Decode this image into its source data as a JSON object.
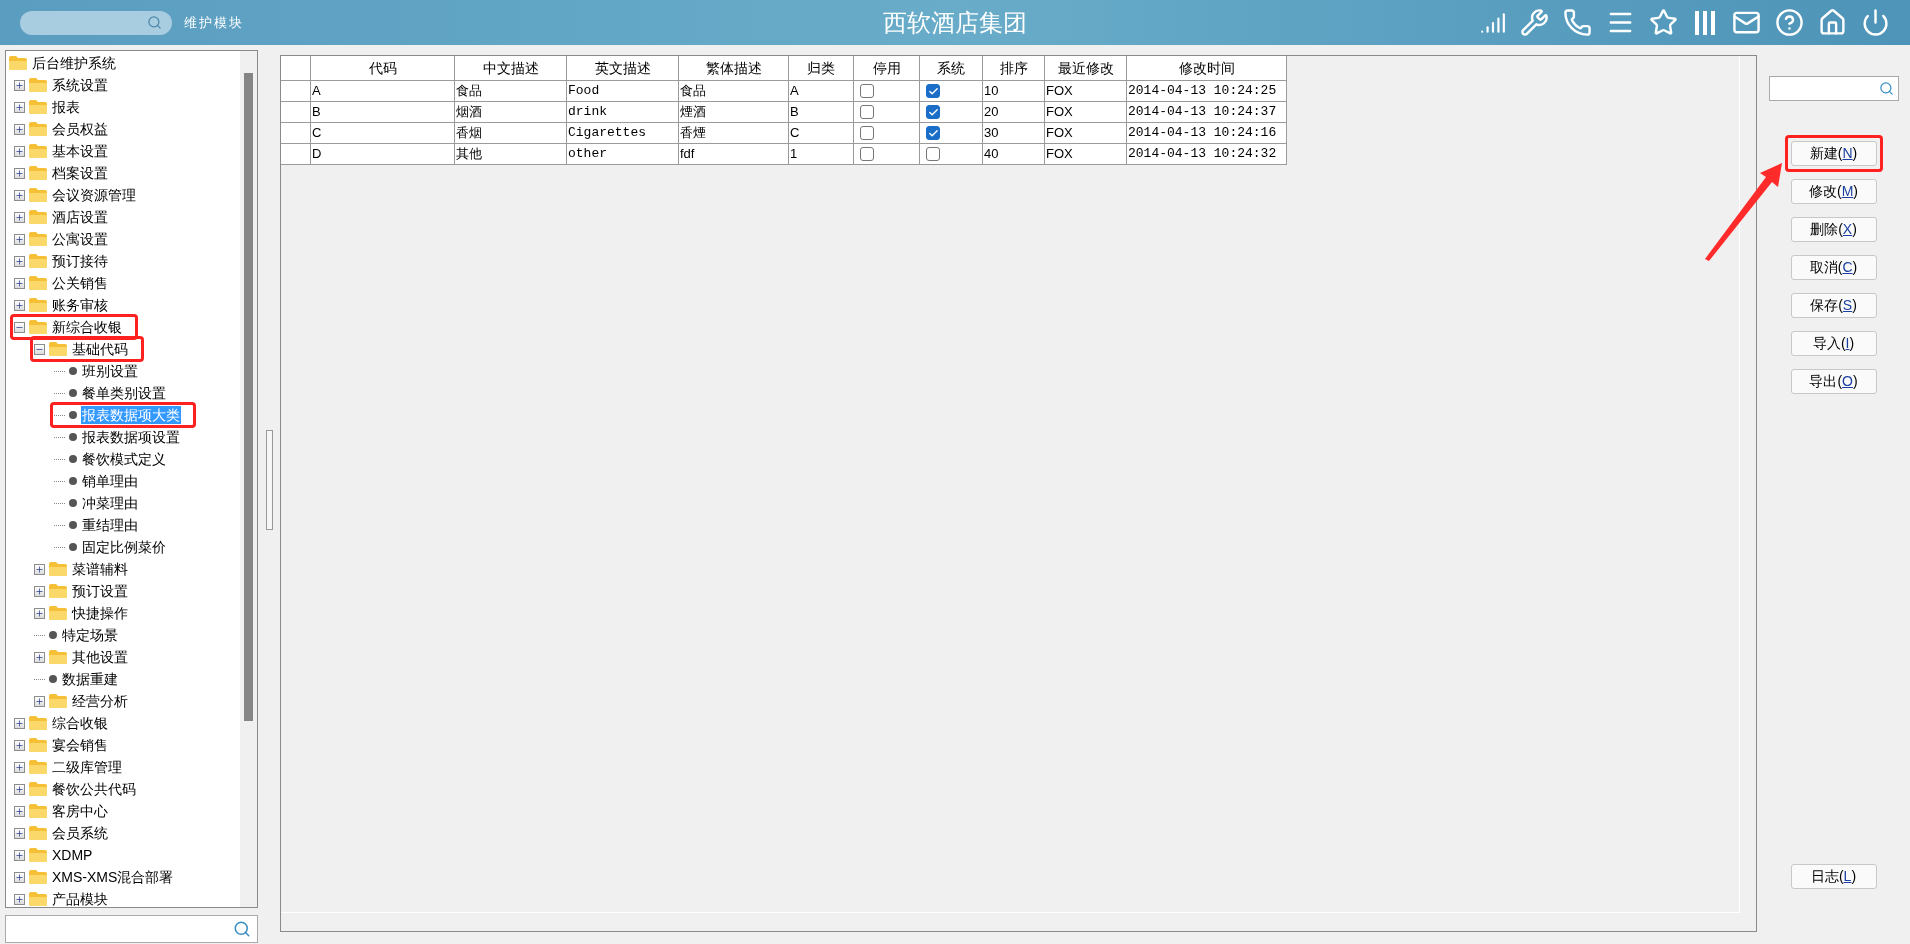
{
  "header": {
    "module_label": "维护模块",
    "title": "西软酒店集团"
  },
  "tree": {
    "label": "后台维护系统",
    "kind": "root",
    "selected": false,
    "annotated": false,
    "children": [
      {
        "label": "系统设置",
        "kind": "folder",
        "expanded": false,
        "selected": false,
        "annotated": false
      },
      {
        "label": "报表",
        "kind": "folder",
        "expanded": false,
        "selected": false,
        "annotated": false
      },
      {
        "label": "会员权益",
        "kind": "folder",
        "expanded": false,
        "selected": false,
        "annotated": false
      },
      {
        "label": "基本设置",
        "kind": "folder",
        "expanded": false,
        "selected": false,
        "annotated": false
      },
      {
        "label": "档案设置",
        "kind": "folder",
        "expanded": false,
        "selected": false,
        "annotated": false
      },
      {
        "label": "会议资源管理",
        "kind": "folder",
        "expanded": false,
        "selected": false,
        "annotated": false
      },
      {
        "label": "酒店设置",
        "kind": "folder",
        "expanded": false,
        "selected": false,
        "annotated": false
      },
      {
        "label": "公寓设置",
        "kind": "folder",
        "expanded": false,
        "selected": false,
        "annotated": false
      },
      {
        "label": "预订接待",
        "kind": "folder",
        "expanded": false,
        "selected": false,
        "annotated": false
      },
      {
        "label": "公关销售",
        "kind": "folder",
        "expanded": false,
        "selected": false,
        "annotated": false
      },
      {
        "label": "账务审核",
        "kind": "folder",
        "expanded": false,
        "selected": false,
        "annotated": false
      },
      {
        "label": "新综合收银",
        "kind": "folder",
        "expanded": true,
        "selected": false,
        "annotated": true,
        "children": [
          {
            "label": "基础代码",
            "kind": "folder",
            "expanded": true,
            "selected": false,
            "annotated": true,
            "children": [
              {
                "label": "班别设置",
                "kind": "leaf",
                "selected": false,
                "annotated": false
              },
              {
                "label": "餐单类别设置",
                "kind": "leaf",
                "selected": false,
                "annotated": false
              },
              {
                "label": "报表数据项大类",
                "kind": "leaf",
                "selected": true,
                "annotated": true
              },
              {
                "label": "报表数据项设置",
                "kind": "leaf",
                "selected": false,
                "annotated": false
              },
              {
                "label": "餐饮模式定义",
                "kind": "leaf",
                "selected": false,
                "annotated": false
              },
              {
                "label": "销单理由",
                "kind": "leaf",
                "selected": false,
                "annotated": false
              },
              {
                "label": "冲菜理由",
                "kind": "leaf",
                "selected": false,
                "annotated": false
              },
              {
                "label": "重结理由",
                "kind": "leaf",
                "selected": false,
                "annotated": false
              },
              {
                "label": "固定比例菜价",
                "kind": "leaf",
                "selected": false,
                "annotated": false
              }
            ]
          },
          {
            "label": "菜谱辅料",
            "kind": "folder",
            "expanded": false,
            "selected": false,
            "annotated": false
          },
          {
            "label": "预订设置",
            "kind": "folder",
            "expanded": false,
            "selected": false,
            "annotated": false
          },
          {
            "label": "快捷操作",
            "kind": "folder",
            "expanded": false,
            "selected": false,
            "annotated": false
          },
          {
            "label": "特定场景",
            "kind": "leaf",
            "selected": false,
            "annotated": false
          },
          {
            "label": "其他设置",
            "kind": "folder",
            "expanded": false,
            "selected": false,
            "annotated": false
          },
          {
            "label": "数据重建",
            "kind": "leaf",
            "selected": false,
            "annotated": false
          },
          {
            "label": "经营分析",
            "kind": "folder",
            "expanded": false,
            "selected": false,
            "annotated": false
          }
        ]
      },
      {
        "label": "综合收银",
        "kind": "folder",
        "expanded": false,
        "selected": false,
        "annotated": false
      },
      {
        "label": "宴会销售",
        "kind": "folder",
        "expanded": false,
        "selected": false,
        "annotated": false
      },
      {
        "label": "二级库管理",
        "kind": "folder",
        "expanded": false,
        "selected": false,
        "annotated": false
      },
      {
        "label": "餐饮公共代码",
        "kind": "folder",
        "expanded": false,
        "selected": false,
        "annotated": false
      },
      {
        "label": "客房中心",
        "kind": "folder",
        "expanded": false,
        "selected": false,
        "annotated": false
      },
      {
        "label": "会员系统",
        "kind": "folder",
        "expanded": false,
        "selected": false,
        "annotated": false
      },
      {
        "label": "XDMP",
        "kind": "folder",
        "expanded": false,
        "selected": false,
        "annotated": false
      },
      {
        "label": "XMS-XMS混合部署",
        "kind": "folder",
        "expanded": false,
        "selected": false,
        "annotated": false
      },
      {
        "label": "产品模块",
        "kind": "folder",
        "expanded": false,
        "selected": false,
        "annotated": false
      }
    ]
  },
  "table": {
    "columns": [
      "代码",
      "中文描述",
      "英文描述",
      "繁体描述",
      "归类",
      "停用",
      "系统",
      "排序",
      "最近修改",
      "修改时间"
    ],
    "rows": [
      {
        "code": "A",
        "zh": "食品",
        "en": "Food",
        "tw": "食品",
        "category": "A",
        "disabled": false,
        "system": true,
        "order": "10",
        "modified_by": "FOX",
        "modified_at": "2014-04-13 10:24:25"
      },
      {
        "code": "B",
        "zh": "烟酒",
        "en": "drink",
        "tw": "煙酒",
        "category": "B",
        "disabled": false,
        "system": true,
        "order": "20",
        "modified_by": "FOX",
        "modified_at": "2014-04-13 10:24:37"
      },
      {
        "code": "C",
        "zh": "香烟",
        "en": "Cigarettes",
        "tw": "香煙",
        "category": "C",
        "disabled": false,
        "system": true,
        "order": "30",
        "modified_by": "FOX",
        "modified_at": "2014-04-13 10:24:16"
      },
      {
        "code": "D",
        "zh": "其他",
        "en": "other",
        "tw": "fdf",
        "category": "1",
        "disabled": false,
        "system": false,
        "order": "40",
        "modified_by": "FOX",
        "modified_at": "2014-04-13 10:24:32"
      }
    ]
  },
  "actions": {
    "buttons": [
      {
        "label": "新建(N)",
        "annotated": true
      },
      {
        "label": "修改(M)",
        "annotated": false
      },
      {
        "label": "删除(X)",
        "annotated": false
      },
      {
        "label": "取消(C)",
        "annotated": false
      },
      {
        "label": "保存(S)",
        "annotated": false
      },
      {
        "label": "导入(I)",
        "annotated": false
      },
      {
        "label": "导出(O)",
        "annotated": false
      }
    ],
    "log_button": {
      "label": "日志(L)",
      "annotated": false
    }
  }
}
